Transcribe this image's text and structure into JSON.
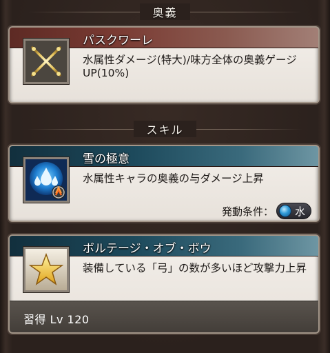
{
  "sections": {
    "ougi_header": "奥義",
    "skill_header": "スキル"
  },
  "ougi": {
    "title": "パスクワーレ",
    "description": "水属性ダメージ(特大)/味方全体の奥義ゲージUP(10%)",
    "icon": "crossed-swords-icon"
  },
  "skills": [
    {
      "title": "雪の極意",
      "description": "水属性キャラの奥義の与ダメージ上昇",
      "icon": "water-drops-icon",
      "condition_label": "発動条件：",
      "condition_element": "水",
      "element_color": "#2f9ad6"
    },
    {
      "title": "ボルテージ・オブ・ボウ",
      "description": "装備している「弓」の数が多いほど攻撃力上昇",
      "icon": "star-icon",
      "learn_text": "習得 Lv 120"
    }
  ]
}
